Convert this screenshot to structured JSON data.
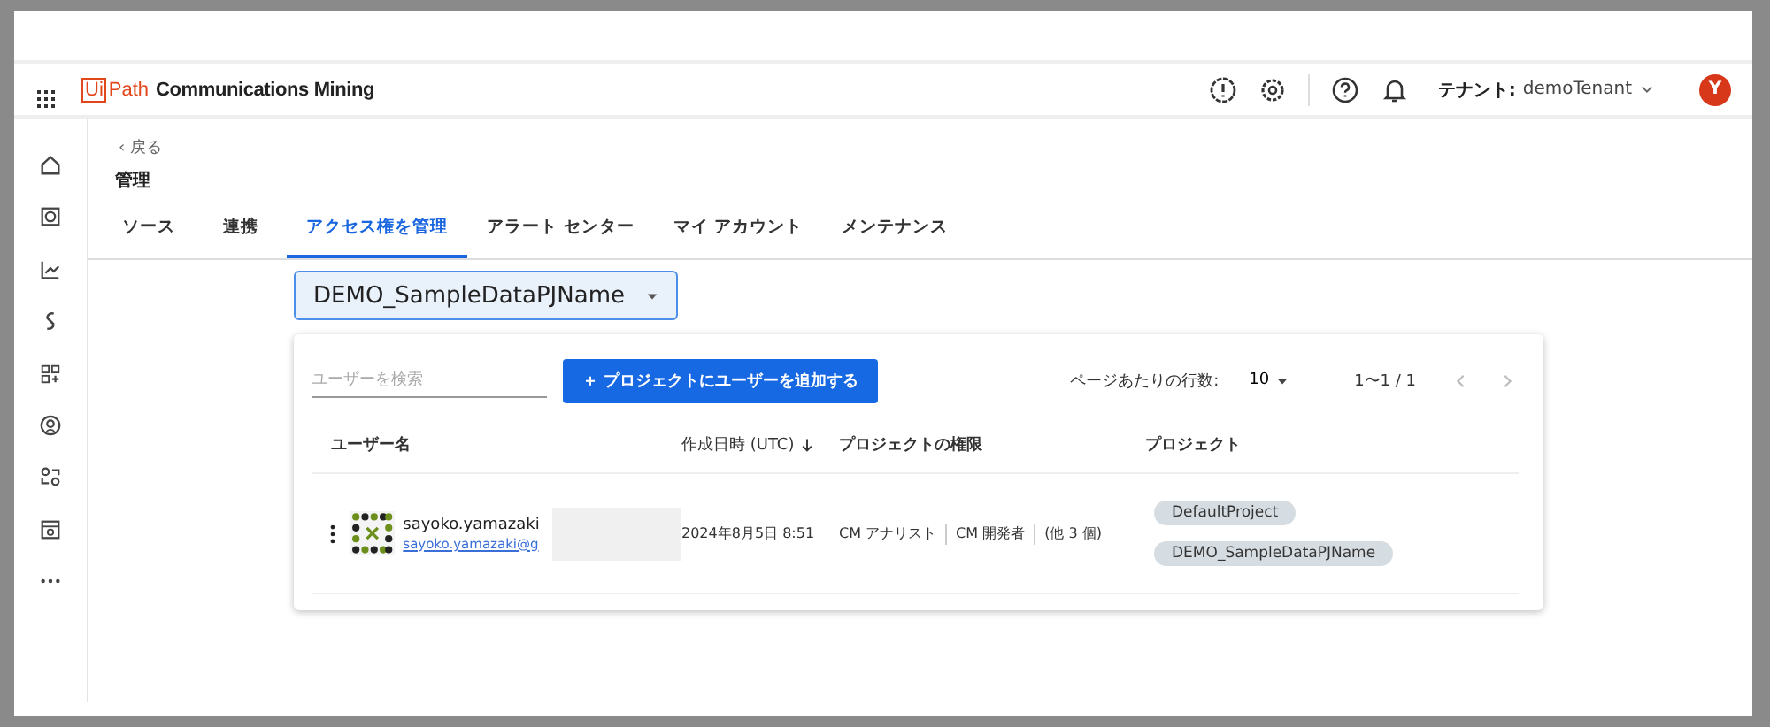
{
  "header": {
    "logo_mark": "Ui",
    "logo_text": "Path",
    "product": "Communications Mining",
    "tenant_label": "テナント:",
    "tenant_name": "demoTenant",
    "avatar_letter": "Y"
  },
  "back_link": "‹ 戻る",
  "page_title": "管理",
  "tabs": [
    {
      "label": "ソース",
      "selected": false
    },
    {
      "label": "連携",
      "selected": false
    },
    {
      "label": "アクセス権を管理",
      "selected": true
    },
    {
      "label": "アラート センター",
      "selected": false
    },
    {
      "label": "マイ アカウント",
      "selected": false
    },
    {
      "label": "メンテナンス",
      "selected": false
    }
  ],
  "project_select": {
    "value": "DEMO_SampleDataPJName"
  },
  "toolbar": {
    "search_placeholder": "ユーザーを検索",
    "add_button": "＋ プロジェクトにユーザーを追加する",
    "rows_per_page_label": "ページあたりの行数:",
    "rows_per_page": "10",
    "range": "1〜1 / 1"
  },
  "table": {
    "columns": [
      "ユーザー名",
      "作成日時 (UTC)",
      "プロジェクトの権限",
      "プロジェクト"
    ],
    "rows": [
      {
        "name": "sayoko.yamazaki",
        "email": "sayoko.yamazaki@g",
        "created": "2024年8月5日 8:51",
        "permissions": [
          "CM アナリスト",
          "CM 開発者",
          "(他 3 個)"
        ],
        "projects": [
          "DefaultProject",
          "DEMO_SampleDataPJName"
        ]
      }
    ]
  }
}
